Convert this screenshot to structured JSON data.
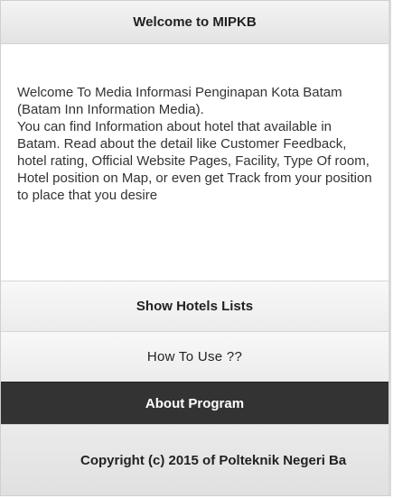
{
  "header": {
    "title": "Welcome to MIPKB"
  },
  "main": {
    "paragraph_1": "Welcome To Media Informasi Penginapan Kota Batam (Batam Inn Information Media).",
    "paragraph_2": "You can find Information about hotel that available in Batam. Read about the detail like Customer Feedback, hotel rating, Official Website Pages, Facility, Type Of room, Hotel position on Map, or even get Track from your position to place that you desire"
  },
  "nav": {
    "show_hotels_label": "Show Hotels Lists",
    "how_to_use_label": "How To Use ??",
    "about_program_label": "About Program"
  },
  "footer": {
    "copyright": "Copyright (c) 2015 of Polteknik Negeri Ba"
  },
  "colors": {
    "header_bg": "#e9e9e9",
    "active_button_bg": "#333333",
    "active_button_text": "#ffffff"
  }
}
